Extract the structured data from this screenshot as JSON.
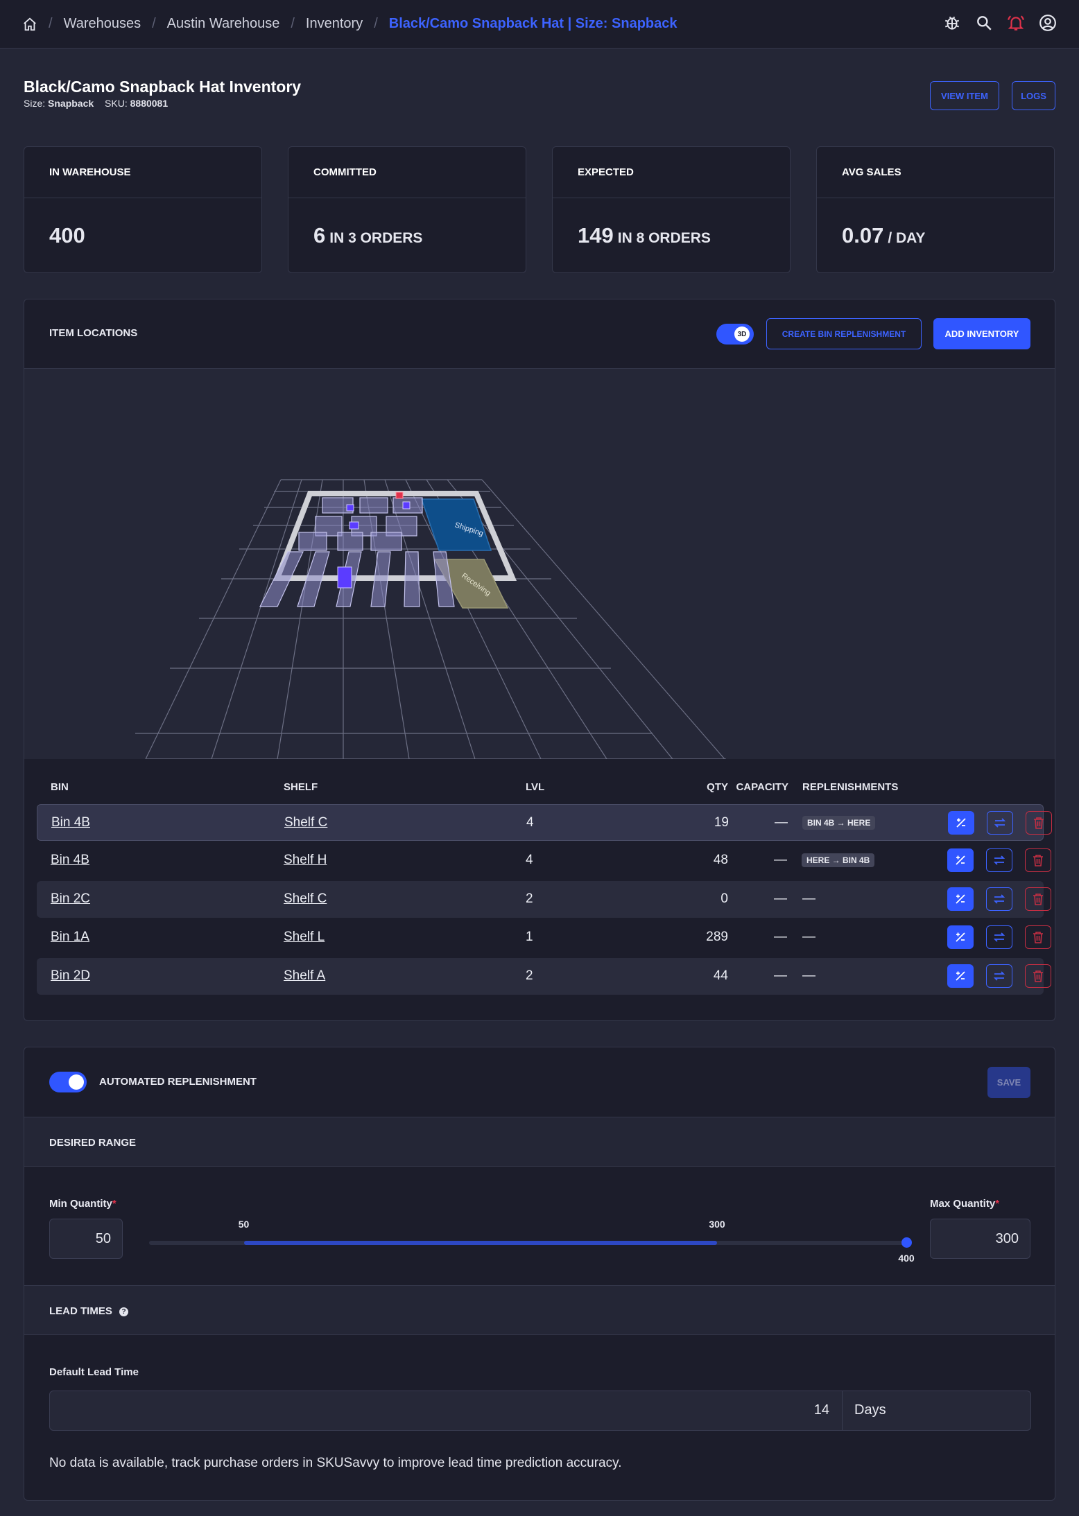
{
  "breadcrumb": [
    "Warehouses",
    "Austin Warehouse",
    "Inventory",
    "Black/Camo Snapback Hat | Size: Snapback"
  ],
  "header": {
    "title": "Black/Camo Snapback Hat Inventory",
    "size_label": "Size:",
    "size_value": "Snapback",
    "sku_label": "SKU:",
    "sku_value": "8880081",
    "view_item": "VIEW ITEM",
    "logs": "LOGS"
  },
  "stats": [
    {
      "label": "IN WAREHOUSE",
      "value": "400",
      "unit": ""
    },
    {
      "label": "COMMITTED",
      "value": "6",
      "unit": "IN 3 ORDERS"
    },
    {
      "label": "EXPECTED",
      "value": "149",
      "unit": "IN 8 ORDERS"
    },
    {
      "label": "AVG SALES",
      "value": "0.07",
      "unit": "/ DAY"
    }
  ],
  "locations": {
    "title": "ITEM LOCATIONS",
    "toggle_label": "3D",
    "create_bin": "CREATE BIN REPLENISHMENT",
    "add_inventory": "ADD INVENTORY",
    "map_labels": {
      "shipping": "Shipping",
      "receiving": "Receiving"
    },
    "columns": [
      "BIN",
      "SHELF",
      "LVL",
      "QTY",
      "CAPACITY",
      "REPLENISHMENTS"
    ],
    "rows": [
      {
        "bin": "Bin 4B",
        "shelf": "Shelf C",
        "lvl": "4",
        "qty": "19",
        "capacity": "—",
        "repl": "BIN 4B → HERE"
      },
      {
        "bin": "Bin 4B",
        "shelf": "Shelf H",
        "lvl": "4",
        "qty": "48",
        "capacity": "—",
        "repl": "HERE → BIN 4B"
      },
      {
        "bin": "Bin 2C",
        "shelf": "Shelf C",
        "lvl": "2",
        "qty": "0",
        "capacity": "—",
        "repl": "—"
      },
      {
        "bin": "Bin 1A",
        "shelf": "Shelf L",
        "lvl": "1",
        "qty": "289",
        "capacity": "—",
        "repl": "—"
      },
      {
        "bin": "Bin 2D",
        "shelf": "Shelf A",
        "lvl": "2",
        "qty": "44",
        "capacity": "—",
        "repl": "—"
      }
    ]
  },
  "replenishment": {
    "title": "AUTOMATED REPLENISHMENT",
    "enabled": true,
    "save": "SAVE",
    "desired_range": "DESIRED RANGE",
    "min_label": "Min Quantity",
    "max_label": "Max Quantity",
    "min_value": "50",
    "max_value": "300",
    "slider_min": "50",
    "slider_max": "300",
    "slider_end": "400",
    "slider_range": {
      "min": 50,
      "max": 300,
      "end": 400
    },
    "lead_times": "LEAD TIMES",
    "default_lead_label": "Default Lead Time",
    "lead_value": "14",
    "lead_unit": "Days",
    "note": "No data is available, track purchase orders in SKUSavvy to improve lead time prediction accuracy."
  },
  "colors": {
    "accent": "#3056ff",
    "danger": "#c42e43",
    "background": "#242636",
    "panel": "#1c1d2b"
  }
}
